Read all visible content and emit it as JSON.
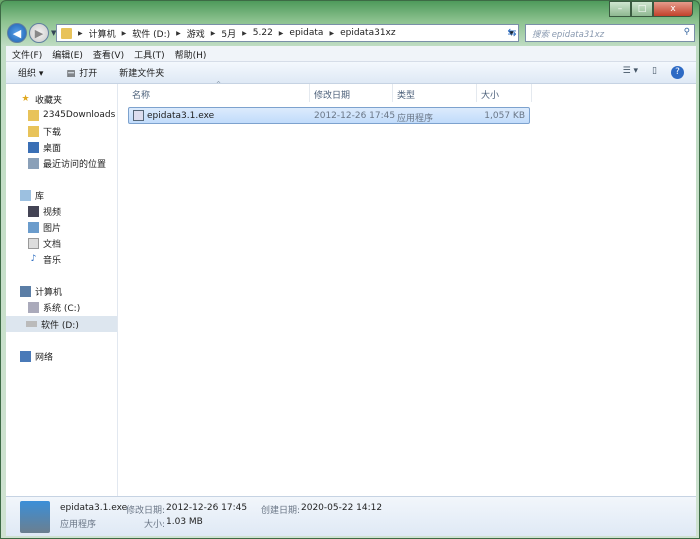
{
  "window": {
    "minimize": "–",
    "maximize": "□",
    "close": "x"
  },
  "address": {
    "path": [
      "计算机",
      "软件 (D:)",
      "游戏",
      "5月",
      "5.22",
      "epidata",
      "epidata31xz"
    ]
  },
  "search": {
    "placeholder": "搜索 epidata31xz"
  },
  "menu": [
    "文件(F)",
    "编辑(E)",
    "查看(V)",
    "工具(T)",
    "帮助(H)"
  ],
  "toolbar": {
    "organize": "组织 ▾",
    "open": "打开",
    "new_folder": "新建文件夹"
  },
  "sidebar": {
    "favorites": {
      "label": "收藏夹",
      "items": [
        "2345Downloads",
        "下载",
        "桌面",
        "最近访问的位置"
      ]
    },
    "libraries": {
      "label": "库",
      "items": [
        "视频",
        "图片",
        "文档",
        "音乐"
      ]
    },
    "computer": {
      "label": "计算机",
      "items": [
        "系统 (C:)",
        "软件 (D:)"
      ]
    },
    "network": {
      "label": "网络"
    }
  },
  "columns": [
    "名称",
    "修改日期",
    "类型",
    "大小"
  ],
  "files": [
    {
      "name": "epidata3.1.exe",
      "modified": "2012-12-26 17:45",
      "type": "应用程序",
      "size": "1,057 KB"
    }
  ],
  "details": {
    "name": "epidata3.1.exe",
    "type": "应用程序",
    "modified_label": "修改日期:",
    "modified": "2012-12-26 17:45",
    "size_label": "大小:",
    "size": "1.03 MB",
    "created_label": "创建日期:",
    "created": "2020-05-22 14:12"
  }
}
